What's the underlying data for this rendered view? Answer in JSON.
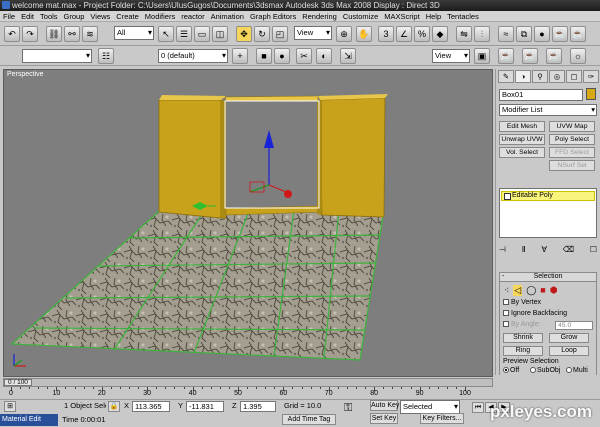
{
  "app": {
    "title": "welcome mat.max    - Project Folder: C:\\Users\\UlusGugos\\Documents\\3dsmax                Autodesk 3ds Max 2008                    Display : Direct 3D"
  },
  "menu": [
    "File",
    "Edit",
    "Tools",
    "Group",
    "Views",
    "Create",
    "Modifiers",
    "reactor",
    "Animation",
    "Graph Editors",
    "Rendering",
    "Customize",
    "MAXScript",
    "Help",
    "Tentacles"
  ],
  "toolbar": {
    "selection_filter": "All",
    "ref_coord": "View",
    "layer": "0 (default)",
    "named_sel": "",
    "snap_view": "View"
  },
  "viewport": {
    "label": "Perspective"
  },
  "command_panel": {
    "object_name": "Box01",
    "object_color": "#d7a915",
    "modifier_list": "Modifier List",
    "mod_buttons": [
      "Edit Mesh",
      "UVW Map",
      "Unwrap UVW",
      "Poly Select",
      "Vol. Select",
      "FFD Select",
      "",
      "NSurf Sel"
    ],
    "mod_buttons_disabled": [
      false,
      false,
      false,
      false,
      false,
      true,
      false,
      true
    ],
    "stack_item": "Editable Poly",
    "selection": {
      "title": "Selection",
      "by_vertex": "By Vertex",
      "ignore_backfacing": "Ignore Backfacing",
      "by_angle": "By Angle:",
      "angle_value": "45.0",
      "shrink": "Shrink",
      "grow": "Grow",
      "ring": "Ring",
      "loop": "Loop",
      "preview": "Preview Selection",
      "off": "Off",
      "subobj": "SubObj",
      "multi": "Multi"
    }
  },
  "timeline": {
    "frame": "0 / 100",
    "ticks": [
      "0",
      "10",
      "20",
      "30",
      "40",
      "50",
      "60",
      "70",
      "80",
      "90",
      "100"
    ]
  },
  "status": {
    "selected": "1 Object Sele",
    "x": "113.365",
    "y": "-11.831",
    "z": "1.395",
    "grid": "Grid = 10.0",
    "auto_key": "Auto Key",
    "auto_key_mode": "Selected",
    "set_key": "Set Key",
    "key_filters": "Key Filters...",
    "time": "Time  0:00:01",
    "add_time_tag": "Add Time Tag",
    "task": "Material Edit"
  },
  "watermark": "pxleyes.com"
}
